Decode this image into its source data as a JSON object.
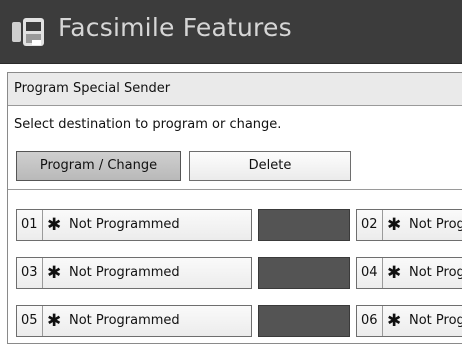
{
  "header": {
    "title": "Facsimile Features",
    "icon": "fax-machine-icon"
  },
  "section": {
    "title": "Program Special Sender",
    "instruction": "Select destination to program or change."
  },
  "buttons": {
    "program_change": "Program / Change",
    "delete": "Delete"
  },
  "entries": [
    {
      "number": "01",
      "marker": "✱",
      "label": "Not Programmed"
    },
    {
      "number": "02",
      "marker": "✱",
      "label": "Not Prog"
    },
    {
      "number": "03",
      "marker": "✱",
      "label": "Not Programmed"
    },
    {
      "number": "04",
      "marker": "✱",
      "label": "Not Prog"
    },
    {
      "number": "05",
      "marker": "✱",
      "label": "Not Programmed"
    },
    {
      "number": "06",
      "marker": "✱",
      "label": "Not Prog"
    }
  ],
  "colors": {
    "title_bar": "#3c3c3c",
    "selected_button": "#c4c4c4",
    "dark_key": "#545454"
  }
}
